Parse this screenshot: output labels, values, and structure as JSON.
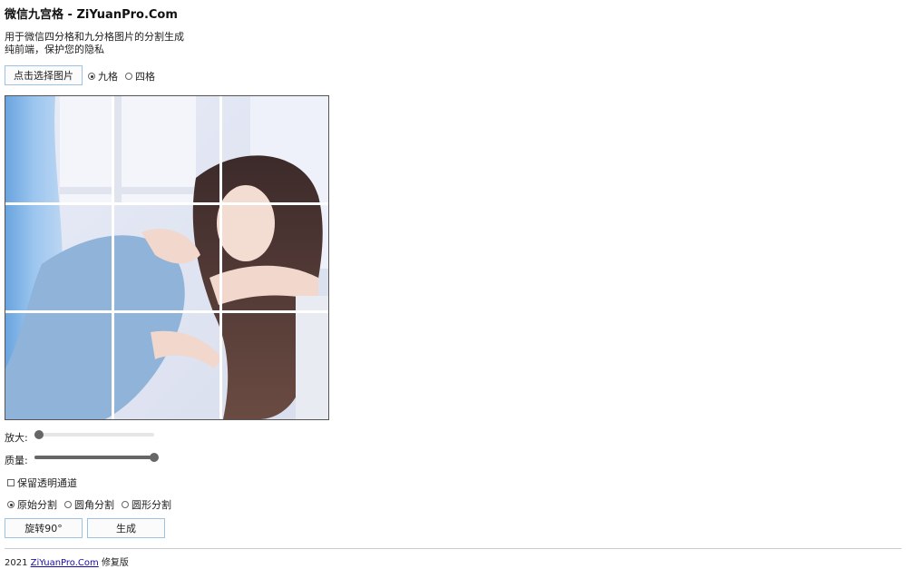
{
  "header": {
    "title": "微信九宫格 - ZiYuanPro.Com",
    "desc_line1": "用于微信四分格和九分格图片的分割生成",
    "desc_line2": "纯前端，保护您的隐私"
  },
  "controls": {
    "select_button": "点击选择图片",
    "grid_options": [
      {
        "label": "九格",
        "checked": true
      },
      {
        "label": "四格",
        "checked": false
      }
    ],
    "zoom_label": "放大:",
    "zoom_value": 0.04,
    "quality_label": "质量:",
    "quality_value": 1.0,
    "keep_alpha_label": "保留透明通道",
    "keep_alpha_checked": false,
    "split_modes": [
      {
        "label": "原始分割",
        "checked": true
      },
      {
        "label": "圆角分割",
        "checked": false
      },
      {
        "label": "圆形分割",
        "checked": false
      }
    ],
    "rotate_button": "旋转90°",
    "generate_button": "生成"
  },
  "footer": {
    "year": "2021",
    "link_text": "ZiYuanPro.Com",
    "suffix": "修复版"
  },
  "colors": {
    "button_border": "#9cc3e6",
    "grid_line": "#ffffff",
    "slider_fill": "#666666"
  }
}
